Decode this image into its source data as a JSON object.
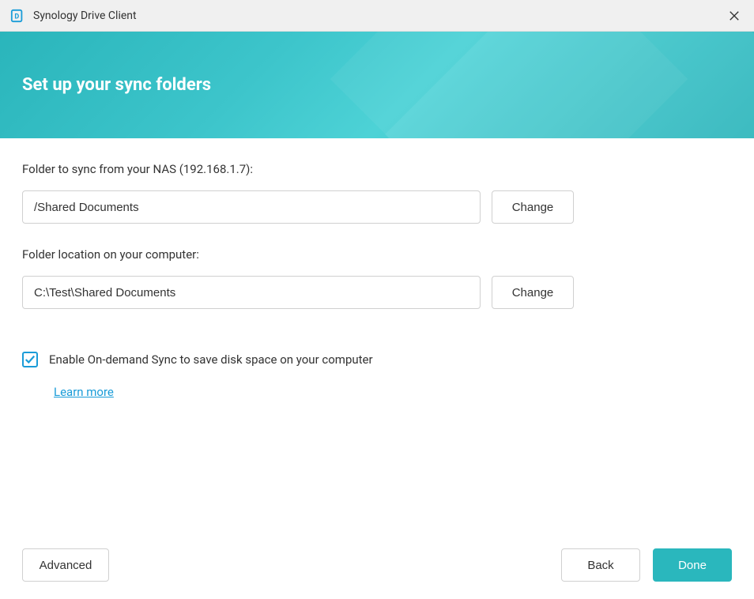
{
  "titlebar": {
    "app_title": "Synology Drive Client"
  },
  "header": {
    "title": "Set up your sync folders"
  },
  "nas_section": {
    "label": "Folder to sync from your NAS (192.168.1.7):",
    "value": "/Shared Documents",
    "change_label": "Change"
  },
  "local_section": {
    "label": "Folder location on your computer:",
    "value": "C:\\Test\\Shared Documents",
    "change_label": "Change"
  },
  "ondemand": {
    "checked": true,
    "label": "Enable On-demand Sync to save disk space on your computer",
    "learn_more": "Learn more"
  },
  "footer": {
    "advanced": "Advanced",
    "back": "Back",
    "done": "Done"
  }
}
